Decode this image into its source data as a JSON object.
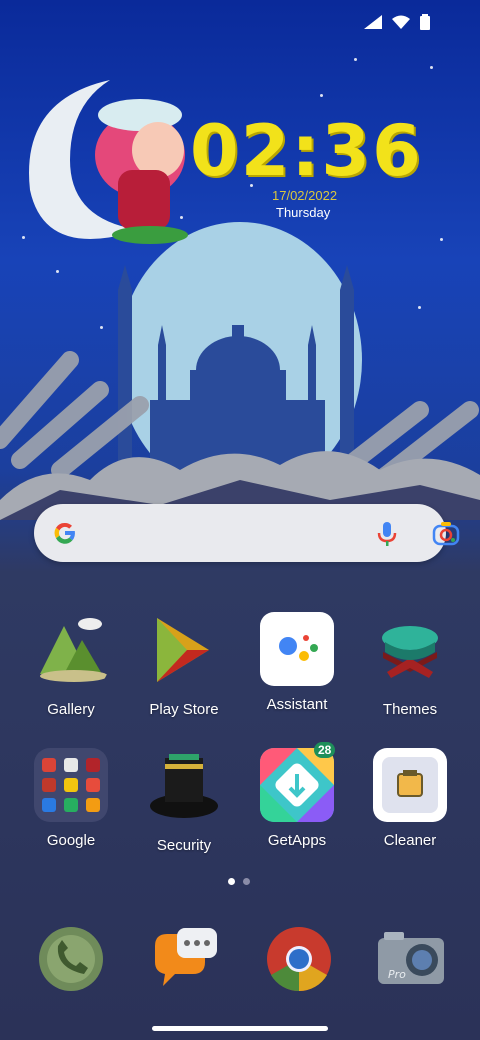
{
  "status": {
    "icons": [
      "signal-icon",
      "wifi-icon",
      "battery-icon"
    ]
  },
  "widget": {
    "time": "02:36",
    "date": "17/02/2022",
    "day": "Thursday"
  },
  "search": {
    "logo": "google-g-icon",
    "mic": "mic-icon",
    "lens": "lens-icon"
  },
  "apps_row1": [
    {
      "label": "Gallery"
    },
    {
      "label": "Play Store"
    },
    {
      "label": "Assistant"
    },
    {
      "label": "Themes"
    }
  ],
  "apps_row2": [
    {
      "label": "Google"
    },
    {
      "label": "Security"
    },
    {
      "label": "GetApps",
      "badge": "28"
    },
    {
      "label": "Cleaner"
    }
  ],
  "dock": [
    "phone-icon",
    "messages-icon",
    "chrome-icon",
    "camera-icon"
  ],
  "pages": {
    "current": 1,
    "total": 2
  },
  "colors": {
    "clock": "#f2e21a",
    "date": "#d9c73e",
    "sky": "#1843b8"
  }
}
